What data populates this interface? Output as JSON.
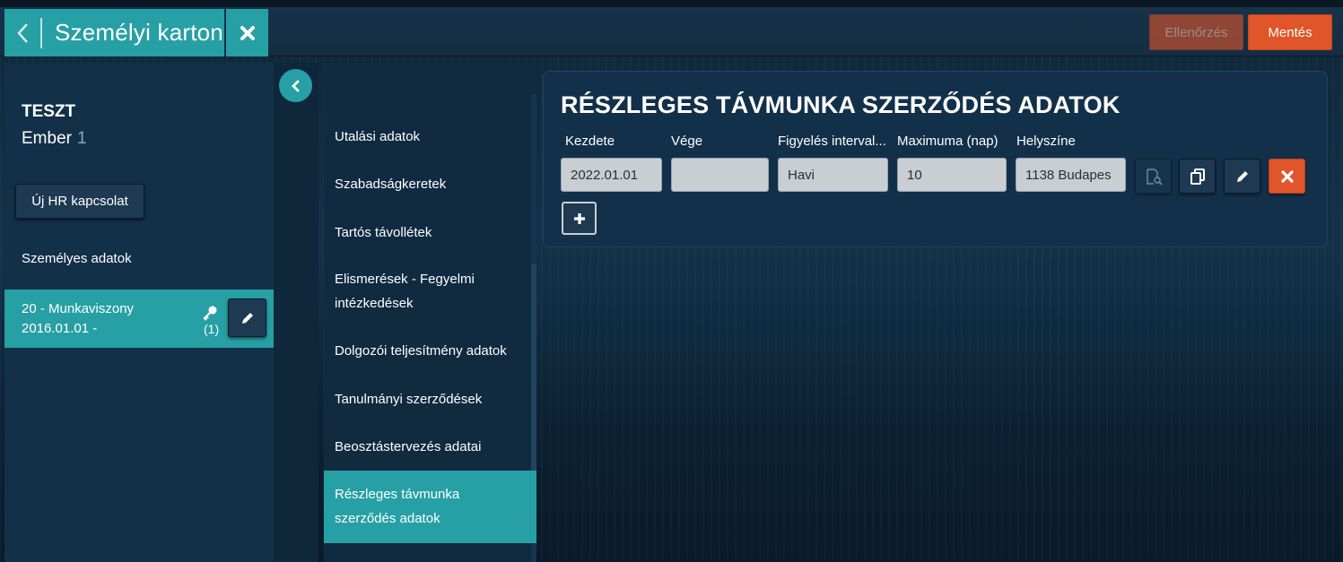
{
  "header": {
    "title": "Személyi karton",
    "check_label": "Ellenőrzés",
    "save_label": "Mentés"
  },
  "person": {
    "first_name": "TESZT",
    "last_name": "Ember",
    "number": "1"
  },
  "left": {
    "new_hr_label": "Új HR kapcsolat",
    "personal_data_label": "Személyes adatok",
    "employment": {
      "line1": "20 - Munkaviszony",
      "line2": "2016.01.01 -",
      "count": "(1)"
    }
  },
  "nav": {
    "items": [
      {
        "label": "Utalási adatok"
      },
      {
        "label": "Szabadságkeretek"
      },
      {
        "label": "Tartós távollétek"
      },
      {
        "label": "Elismerések - Fegyelmi intézkedések"
      },
      {
        "label": "Dolgozói teljesítmény adatok"
      },
      {
        "label": "Tanulmányi szerződések"
      },
      {
        "label": "Beosztástervezés adatai"
      },
      {
        "label": "Részleges távmunka szerződés adatok"
      }
    ],
    "active_index": 7
  },
  "card": {
    "title": "RÉSZLEGES TÁVMUNKA SZERZŐDÉS ADATOK",
    "columns": [
      "Kezdete",
      "Vége",
      "Figyelés interval...",
      "Maximuma (nap)",
      "Helyszíne"
    ],
    "row": {
      "start": "2022.01.01",
      "end": "",
      "interval": "Havi",
      "max_days": "10",
      "location": "1138 Budapes"
    }
  },
  "colors": {
    "teal": "#26a0a4",
    "orange": "#e0552a",
    "panel": "#133049"
  },
  "icons": [
    "chevron-left-icon",
    "close-icon",
    "key-icon",
    "pencil-icon",
    "document-search-icon",
    "copy-icon",
    "plus-icon"
  ]
}
